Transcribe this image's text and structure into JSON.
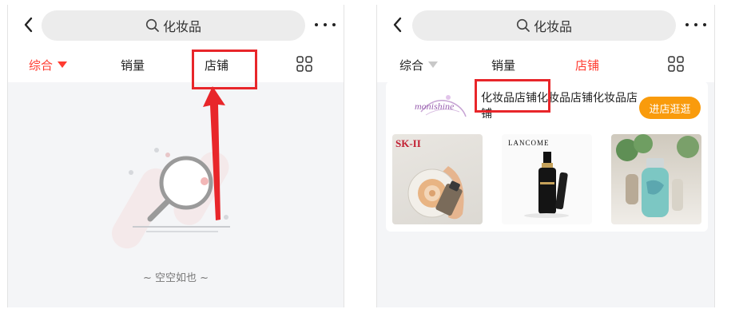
{
  "left_panel": {
    "search": {
      "text": "化妆品"
    },
    "tabs": [
      {
        "label": "综合",
        "active": true
      },
      {
        "label": "销量",
        "active": false
      },
      {
        "label": "店铺",
        "active": false
      }
    ],
    "empty_text": "~ 空空如也 ~"
  },
  "right_panel": {
    "search": {
      "text": "化妆品"
    },
    "tabs": [
      {
        "label": "综合",
        "active": false
      },
      {
        "label": "销量",
        "active": false
      },
      {
        "label": "店铺",
        "active": true
      }
    ],
    "shop": {
      "logo_text": "monishine",
      "name": "化妆品店铺化妆品店铺化妆品店铺",
      "enter_button": "进店逛逛",
      "products": [
        {
          "brand": "SK-II"
        },
        {
          "brand": "LANCOME"
        },
        {
          "brand": ""
        }
      ]
    }
  },
  "colors": {
    "accent": "#ff3b30",
    "annotation": "#e8262a",
    "button": "#f99b0c",
    "page_bg": "#f4f5f7"
  },
  "icons": [
    "back-icon",
    "search-icon",
    "more-icon",
    "sort-arrow-icon",
    "grid-view-icon",
    "magnifier-empty-icon"
  ]
}
